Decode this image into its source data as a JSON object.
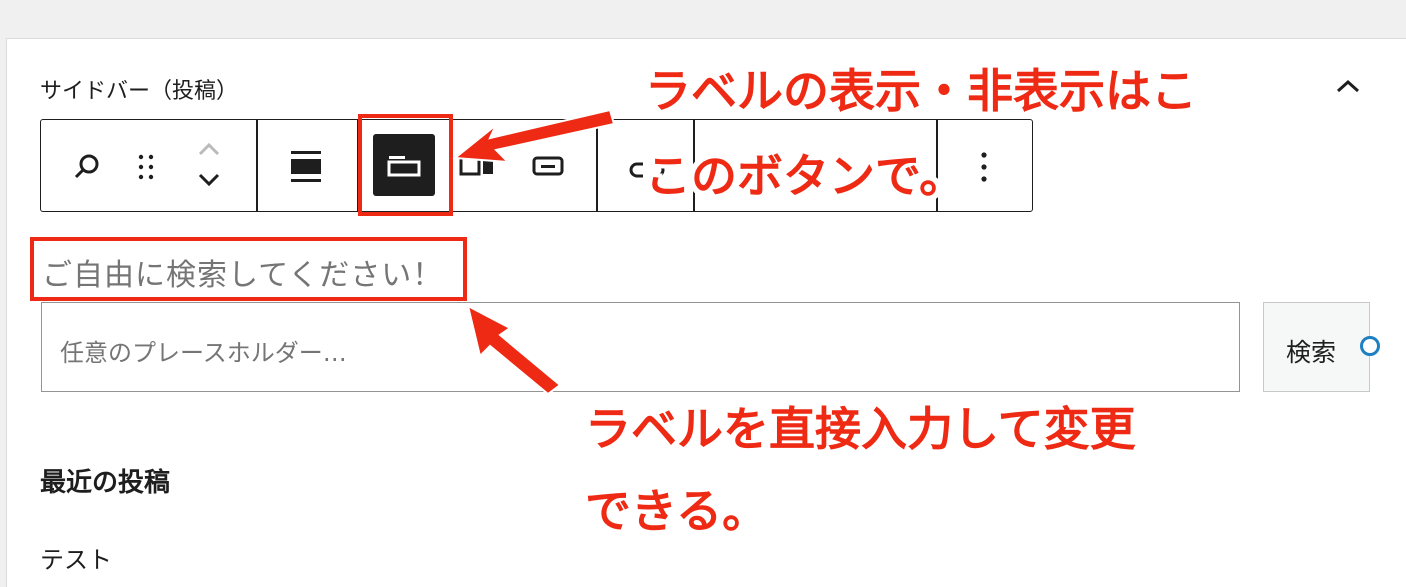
{
  "sidebar": {
    "title": "サイドバー（投稿）"
  },
  "toolbar": {
    "items": [
      "search-icon",
      "drag-handle-icon",
      "move-up-icon",
      "move-down-icon",
      "align-full-icon",
      "toggle-label-icon",
      "button-position-icon",
      "button-inside-icon",
      "link-icon",
      "more-options-icon"
    ]
  },
  "search_block": {
    "label": "ご自由に検索してください！",
    "placeholder": "任意のプレースホルダー…",
    "button_label": "検索"
  },
  "recent_posts": {
    "heading": "最近の投稿",
    "items": [
      "テスト"
    ]
  },
  "annotations": {
    "toolbar_note_line1": "ラベルの表示・非表示はこ",
    "toolbar_note_line2": "このボタンで。",
    "label_note_line1": "ラベルを直接入力して変更",
    "label_note_line2": "できる。",
    "color": "#ee2a14"
  }
}
